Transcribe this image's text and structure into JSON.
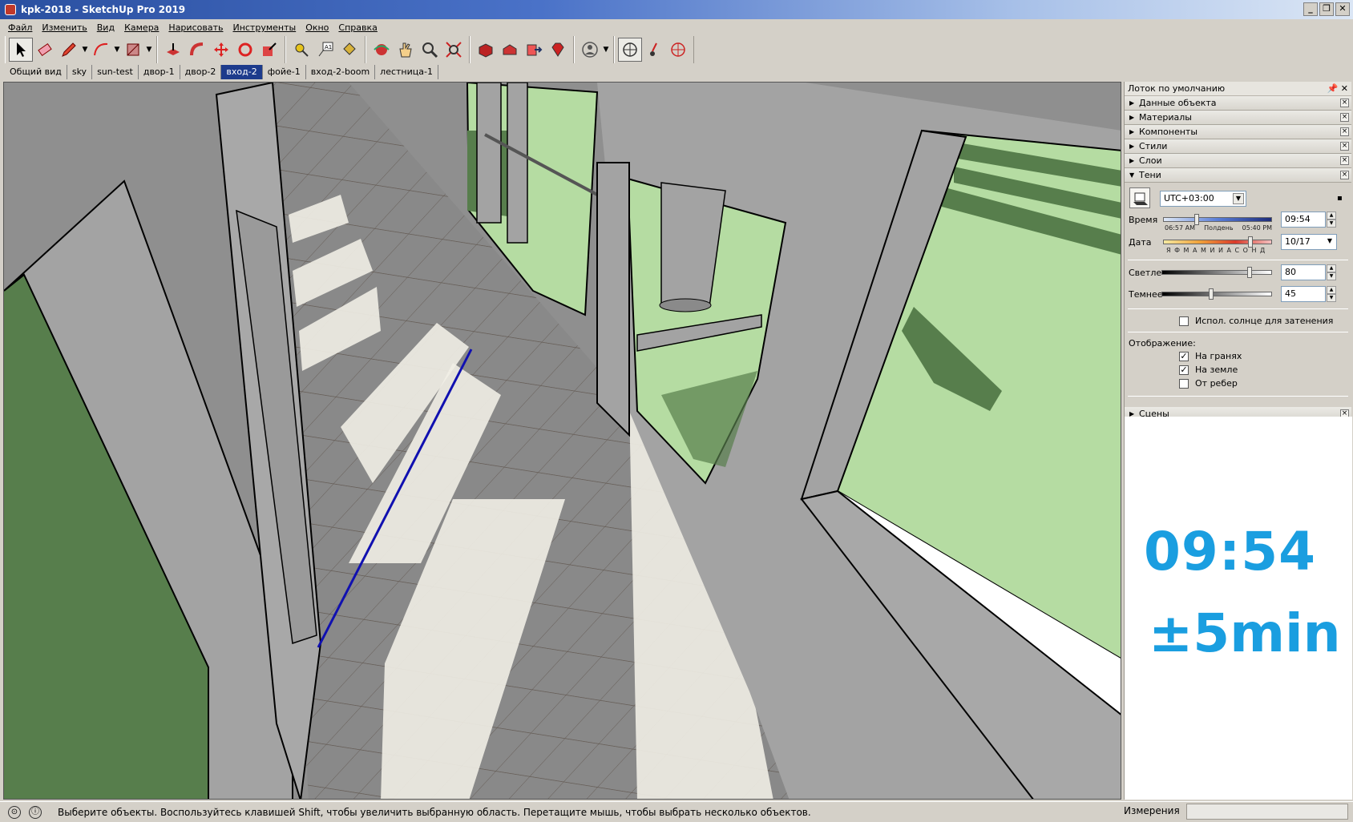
{
  "window": {
    "title": "kpk-2018 - SketchUp Pro 2019"
  },
  "menu": [
    "Файл",
    "Изменить",
    "Вид",
    "Камера",
    "Нарисовать",
    "Инструменты",
    "Окно",
    "Справка"
  ],
  "scene_tabs": [
    {
      "label": "Общий вид",
      "selected": false
    },
    {
      "label": "sky",
      "selected": false
    },
    {
      "label": "sun-test",
      "selected": false
    },
    {
      "label": "двор-1",
      "selected": false
    },
    {
      "label": "двор-2",
      "selected": false
    },
    {
      "label": "вход-2",
      "selected": true
    },
    {
      "label": "фойе-1",
      "selected": false
    },
    {
      "label": "вход-2-boom",
      "selected": false
    },
    {
      "label": "лестница-1",
      "selected": false
    }
  ],
  "tray": {
    "title": "Лоток по умолчанию",
    "panels": [
      "Данные объекта",
      "Материалы",
      "Компоненты",
      "Стили",
      "Слои"
    ],
    "shadows": {
      "title": "Тени",
      "timezone": "UTC+03:00",
      "time_label": "Время",
      "time_value": "09:54",
      "time_ticks": [
        "06:57 AM",
        "Полдень",
        "05:40 PM"
      ],
      "time_fraction": 0.31,
      "date_label": "Дата",
      "date_value": "10/17",
      "date_ticks": "Я Ф М А М И И А С О Н Д",
      "date_fraction": 0.8,
      "light_label": "Светле",
      "light_value": "80",
      "dark_label": "Темнее",
      "dark_value": "45",
      "use_sun_label": "Испол. солнце для затенения",
      "use_sun": false,
      "display_label": "Отображение:",
      "on_faces_label": "На гранях",
      "on_faces": true,
      "on_ground_label": "На земле",
      "on_ground": true,
      "from_edges_label": "От ребер",
      "from_edges": false
    },
    "scenes_panel": "Сцены"
  },
  "overlay": {
    "time": "09:54",
    "tolerance": "±5min"
  },
  "status": {
    "message": "Выберите объекты. Воспользуйтесь клавишей Shift, чтобы увеличить выбранную область. Перетащите мышь, чтобы выбрать несколько объектов.",
    "measure_label": "Измерения"
  },
  "colors": {
    "accent_blue": "#1a9ee0",
    "selected_tab": "#1d3b8c",
    "wall_gray": "#a3a3a3",
    "grass_light": "#b5dca2",
    "grass_dark": "#577e4c"
  }
}
